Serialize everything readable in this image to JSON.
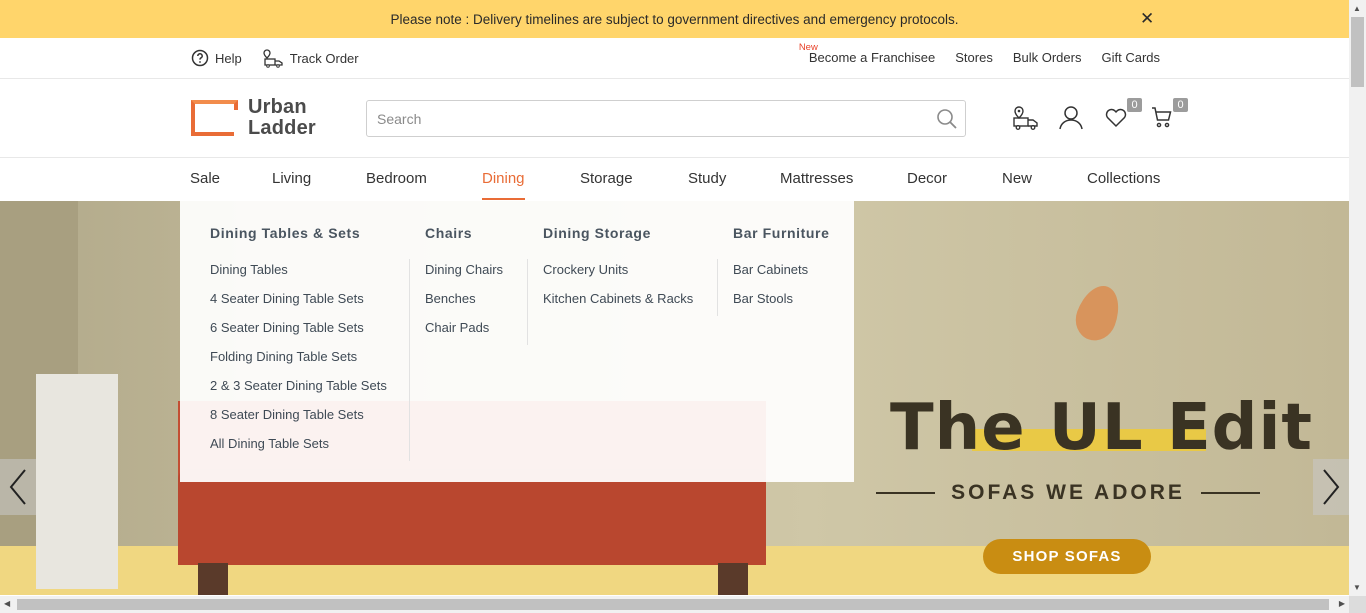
{
  "announcement": {
    "text": "Please note : Delivery timelines are subject to government directives and emergency protocols.",
    "close_icon": "close-icon"
  },
  "utility": {
    "help_label": "Help",
    "track_order_label": "Track Order",
    "new_tag": "New",
    "links": [
      "Become a Franchisee",
      "Stores",
      "Bulk Orders",
      "Gift Cards"
    ]
  },
  "header": {
    "logo_line1": "Urban",
    "logo_line2": "Ladder",
    "search_placeholder": "Search",
    "wishlist_count": "0",
    "cart_count": "0"
  },
  "nav": {
    "items": [
      "Sale",
      "Living",
      "Bedroom",
      "Dining",
      "Storage",
      "Study",
      "Mattresses",
      "Decor",
      "New",
      "Collections"
    ],
    "active": "Dining",
    "accent_color": "#e96c36"
  },
  "mega_menu": {
    "columns": [
      {
        "title": "Dining Tables & Sets",
        "items": [
          "Dining Tables",
          "4 Seater Dining Table Sets",
          "6 Seater Dining Table Sets",
          "Folding Dining Table Sets",
          "2 & 3 Seater Dining Table Sets",
          "8 Seater Dining Table Sets",
          "All Dining Table Sets"
        ]
      },
      {
        "title": "Chairs",
        "items": [
          "Dining Chairs",
          "Benches",
          "Chair Pads"
        ]
      },
      {
        "title": "Dining Storage",
        "items": [
          "Crockery Units",
          "Kitchen Cabinets & Racks"
        ]
      },
      {
        "title": "Bar Furniture",
        "items": [
          "Bar Cabinets",
          "Bar Stools"
        ]
      }
    ]
  },
  "hero": {
    "title_part1": "The ",
    "title_part2": "UL Edit",
    "subtitle": "SOFAS WE ADORE",
    "cta_label": "SHOP SOFAS",
    "cta_color": "#c98d12",
    "highlight_color": "#e9c946"
  }
}
